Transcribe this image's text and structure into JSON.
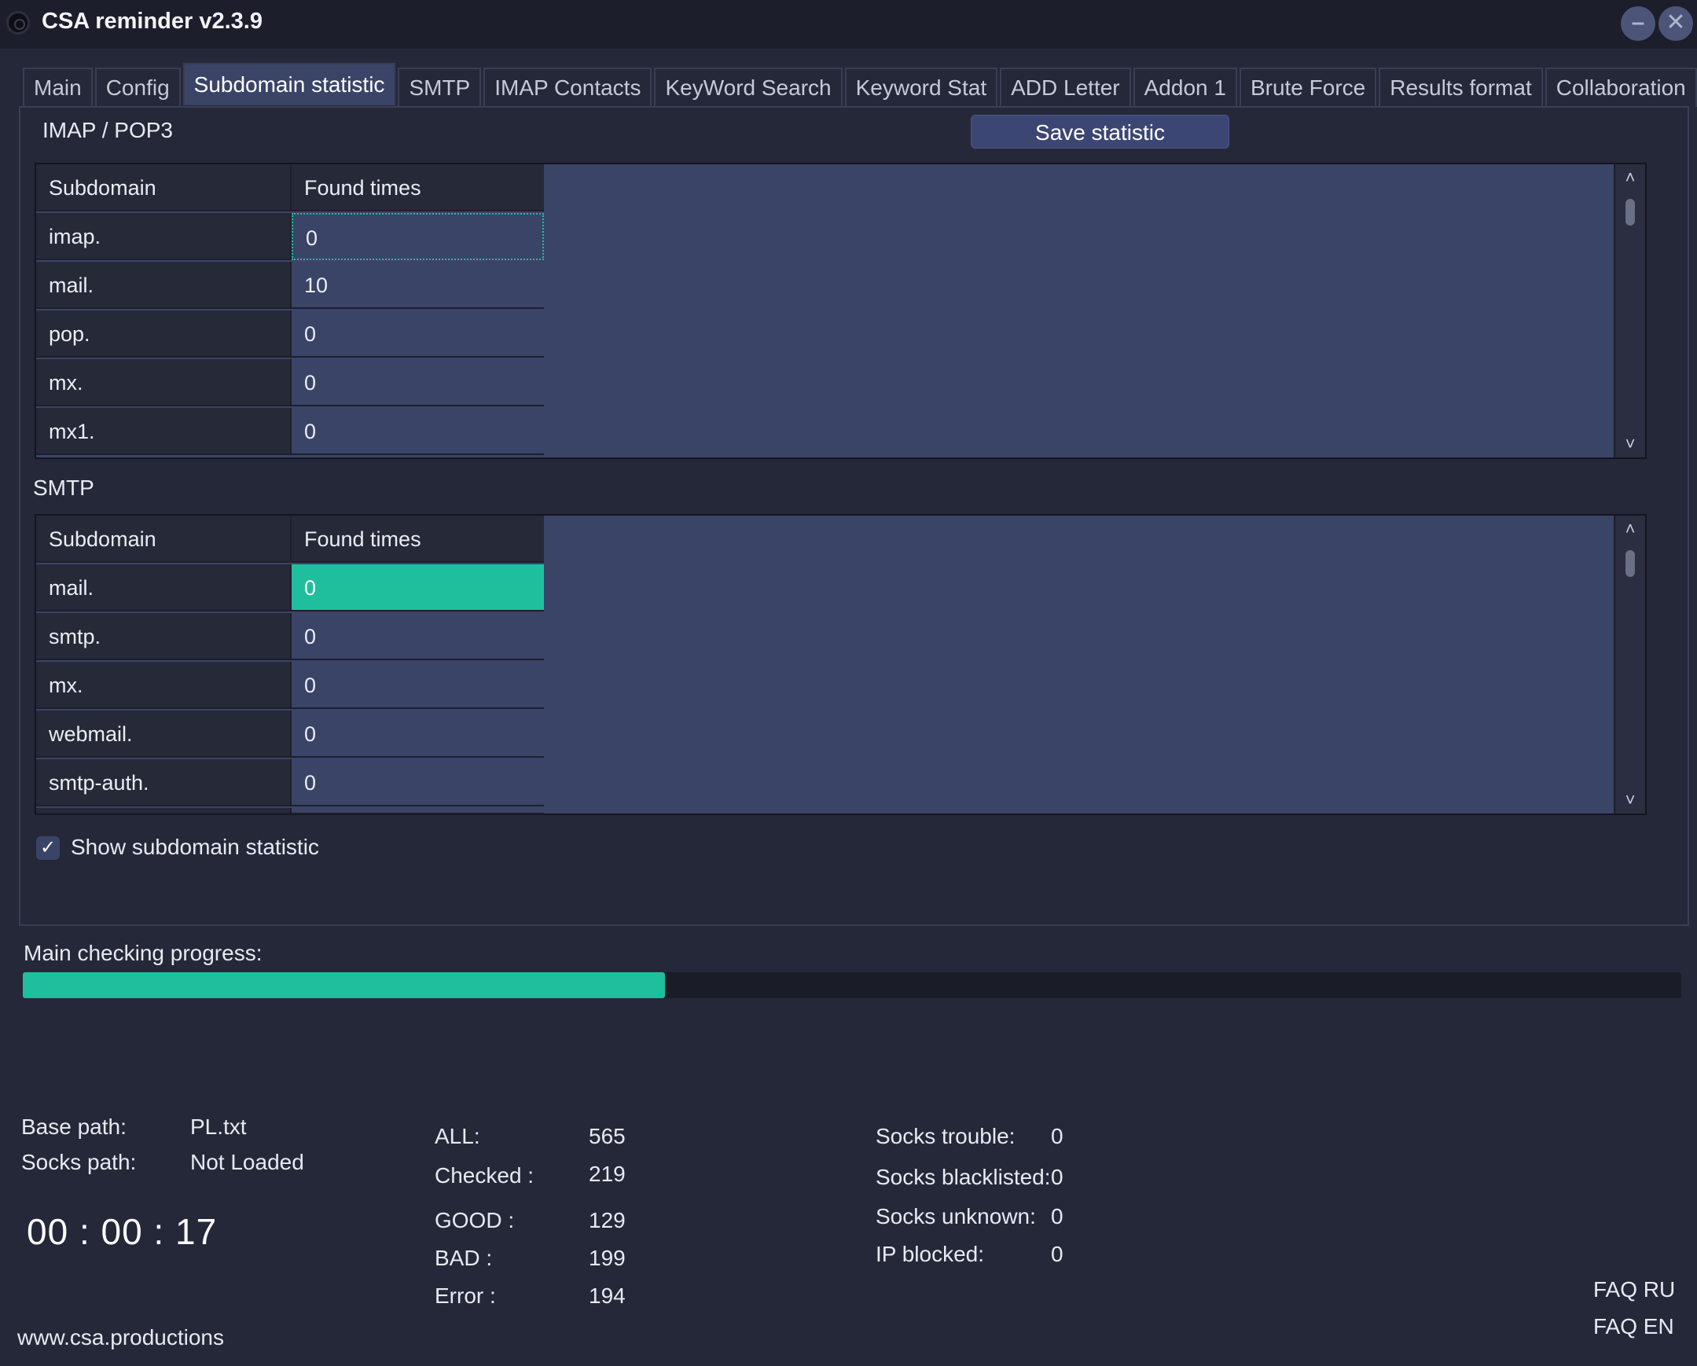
{
  "window": {
    "title": "CSA reminder v2.3.9",
    "minimize_glyph": "–",
    "close_glyph": "✕"
  },
  "tabs": [
    "Main",
    "Config",
    "Subdomain statistic",
    "SMTP",
    "IMAP Contacts",
    "KeyWord Search",
    "Keyword Stat",
    "ADD Letter",
    "Addon 1",
    "Brute Force",
    "Results format",
    "Collaboration"
  ],
  "active_tab": "Subdomain statistic",
  "imap_section": {
    "label": "IMAP / POP3",
    "save_button": "Save statistic",
    "header": {
      "subdomain": "Subdomain",
      "found": "Found times"
    },
    "rows": [
      {
        "subdomain": "imap.",
        "found": "0"
      },
      {
        "subdomain": "mail.",
        "found": "10"
      },
      {
        "subdomain": "pop.",
        "found": "0"
      },
      {
        "subdomain": "mx.",
        "found": "0"
      },
      {
        "subdomain": "mx1.",
        "found": "0"
      }
    ]
  },
  "smtp_section": {
    "label": "SMTP",
    "header": {
      "subdomain": "Subdomain",
      "found": "Found times"
    },
    "rows": [
      {
        "subdomain": "mail.",
        "found": "0"
      },
      {
        "subdomain": "smtp.",
        "found": "0"
      },
      {
        "subdomain": "mx.",
        "found": "0"
      },
      {
        "subdomain": "webmail.",
        "found": "0"
      },
      {
        "subdomain": "smtp-auth.",
        "found": "0"
      }
    ]
  },
  "show_statistic": {
    "label": "Show subdomain statistic",
    "checked": true,
    "glyph": "✓"
  },
  "progress": {
    "label": "Main checking progress:",
    "fraction": 0.387
  },
  "info": {
    "base_path_label": "Base path:",
    "base_path_value": "PL.txt",
    "socks_path_label": "Socks path:",
    "socks_path_value": "Not Loaded",
    "timer": "00 : 00 : 17"
  },
  "counts": {
    "all_label": "ALL:",
    "all": "565",
    "checked_label": "Checked :",
    "checked": "219",
    "good_label": "GOOD :",
    "good": "129",
    "bad_label": "BAD :",
    "bad": "199",
    "error_label": "Error :",
    "error": "194"
  },
  "socks": {
    "trouble_label": "Socks trouble:",
    "trouble": "0",
    "blacklisted_label": "Socks blacklisted:",
    "blacklisted": "0",
    "unknown_label": "Socks unknown:",
    "unknown": "0",
    "ip_blocked_label": "IP blocked:",
    "ip_blocked": "0"
  },
  "links": {
    "faq_ru": "FAQ RU",
    "faq_en": "FAQ EN",
    "website": "www.csa.productions"
  },
  "scroll_glyphs": {
    "up": "˄",
    "down": "˅"
  },
  "colors": {
    "accent": "#1fbf9d",
    "grid_bg": "#3a4467",
    "window_bg": "#252839"
  }
}
